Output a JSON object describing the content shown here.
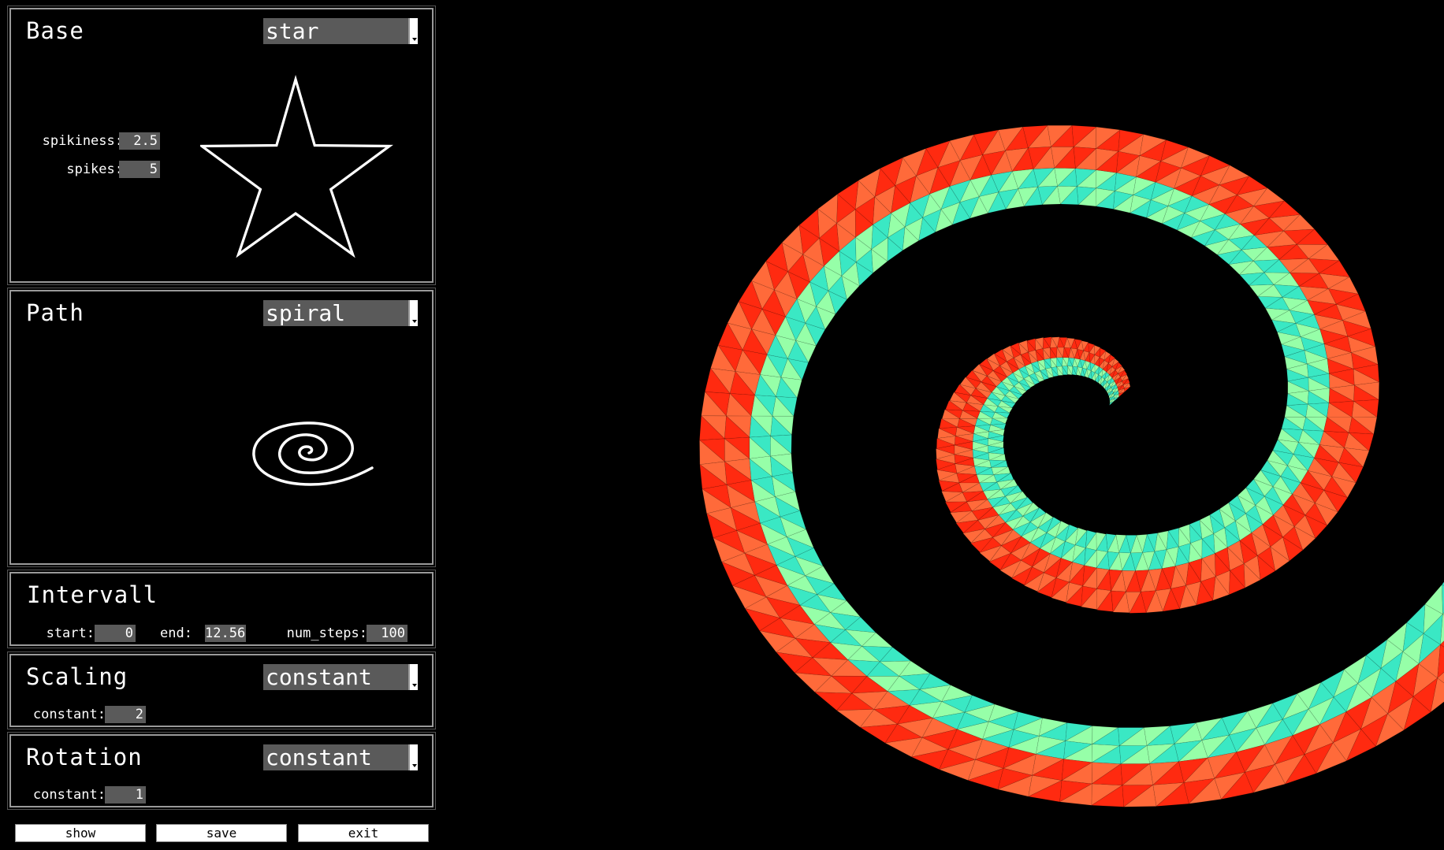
{
  "base": {
    "title": "Base",
    "shape": "star",
    "params": [
      {
        "label": "spikiness:",
        "value": "2.5"
      },
      {
        "label": "spikes:",
        "value": "5"
      }
    ]
  },
  "path": {
    "title": "Path",
    "shape": "spiral"
  },
  "intervall": {
    "title": "Intervall",
    "params": [
      {
        "label": "start:",
        "value": "0"
      },
      {
        "label": "end:",
        "value": "12.56"
      },
      {
        "label": "num_steps:",
        "value": "100"
      }
    ]
  },
  "scaling": {
    "title": "Scaling",
    "mode": "constant",
    "params": [
      {
        "label": "constant:",
        "value": "2"
      }
    ]
  },
  "rotation": {
    "title": "Rotation",
    "mode": "constant",
    "params": [
      {
        "label": "constant:",
        "value": "1"
      }
    ]
  },
  "buttons": {
    "show": "show",
    "save": "save",
    "exit": "exit"
  },
  "colors": {
    "outer_band_red": "#ff2a10",
    "outer_band_orange": "#ff6a3a",
    "inner_band_green": "#96ffa8",
    "inner_band_cyan": "#3ae8c4",
    "tip_blue": "#1aa8e8",
    "tip_violet": "#8a20e8"
  }
}
